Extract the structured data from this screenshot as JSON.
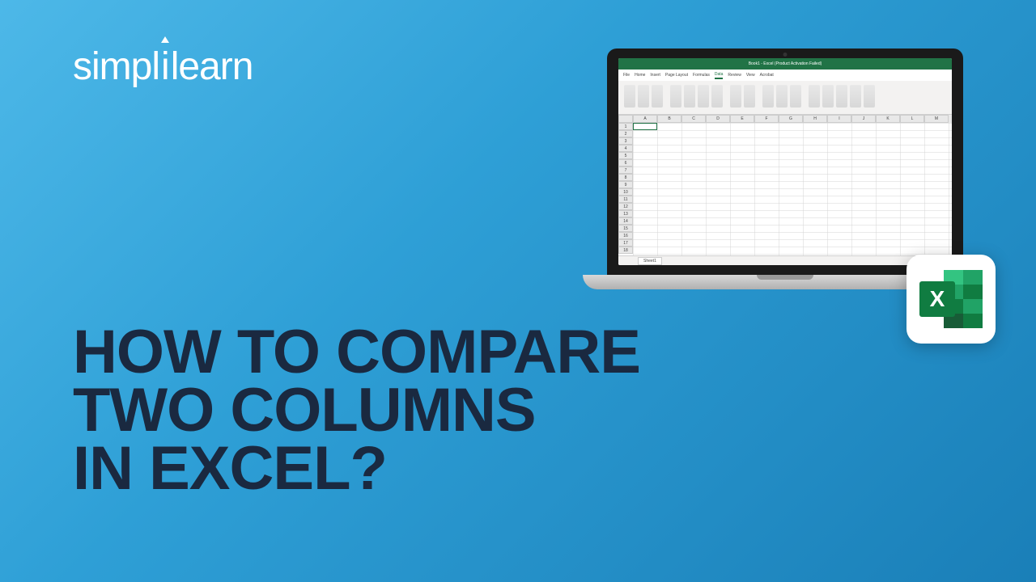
{
  "logo": {
    "part1": "simpl",
    "part2": "i",
    "part3": "learn"
  },
  "title": {
    "line1": "HOW TO COMPARE",
    "line2": "TWO COLUMNS",
    "line3": "IN EXCEL?"
  },
  "excel": {
    "titlebar_left": "",
    "titlebar_center": "Book1 - Excel (Product Activation Failed)",
    "tabs": [
      "File",
      "Home",
      "Insert",
      "Page Layout",
      "Formulas",
      "Data",
      "Review",
      "View",
      "Acrobat"
    ],
    "active_tab_index": 5,
    "columns": [
      "A",
      "B",
      "C",
      "D",
      "E",
      "F",
      "G",
      "H",
      "I",
      "J",
      "K",
      "L",
      "M"
    ],
    "rows": [
      "1",
      "2",
      "3",
      "4",
      "5",
      "6",
      "7",
      "8",
      "9",
      "10",
      "11",
      "12",
      "13",
      "14",
      "15",
      "16",
      "17",
      "18"
    ],
    "sheet_name": "Sheet1",
    "icon_letter": "X"
  }
}
